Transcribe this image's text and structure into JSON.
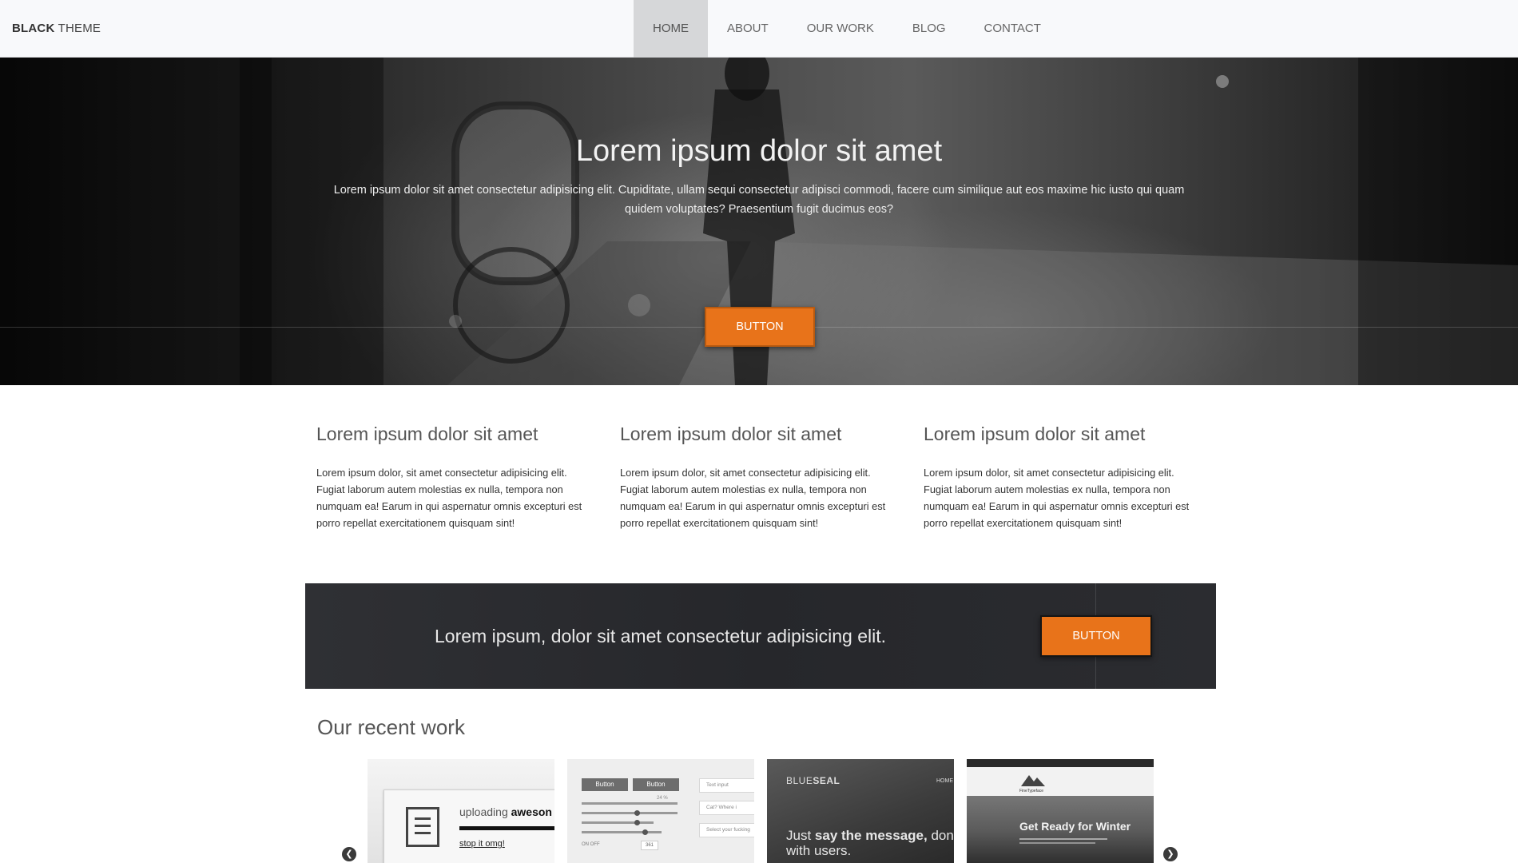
{
  "brand": {
    "bold": "BLACK",
    "light": "THEME"
  },
  "nav": [
    {
      "label": "HOME",
      "active": true
    },
    {
      "label": "ABOUT",
      "active": false
    },
    {
      "label": "OUR WORK",
      "active": false
    },
    {
      "label": "BLOG",
      "active": false
    },
    {
      "label": "CONTACT",
      "active": false
    }
  ],
  "hero": {
    "title": "Lorem ipsum dolor sit amet",
    "text": "Lorem ipsum dolor sit amet consectetur adipisicing elit. Cupiditate, ullam sequi consectetur adipisci commodi, facere cum similique aut eos maxime hic iusto qui quam quidem voluptates? Praesentium fugit ducimus eos?",
    "button": "BUTTON"
  },
  "features": [
    {
      "title": "Lorem ipsum dolor sit amet",
      "text": "Lorem ipsum dolor, sit amet consectetur adipisicing elit. Fugiat laborum autem molestias ex nulla, tempora non numquam ea! Earum in qui aspernatur omnis excepturi est porro repellat exercitationem quisquam sint!"
    },
    {
      "title": "Lorem ipsum dolor sit amet",
      "text": "Lorem ipsum dolor, sit amet consectetur adipisicing elit. Fugiat laborum autem molestias ex nulla, tempora non numquam ea! Earum in qui aspernatur omnis excepturi est porro repellat exercitationem quisquam sint!"
    },
    {
      "title": "Lorem ipsum dolor sit amet",
      "text": "Lorem ipsum dolor, sit amet consectetur adipisicing elit. Fugiat laborum autem molestias ex nulla, tempora non numquam ea! Earum in qui aspernatur omnis excepturi est porro repellat exercitationem quisquam sint!"
    }
  ],
  "cta": {
    "text": "Lorem ipsum, dolor sit amet consectetur adipisicing elit.",
    "button": "BUTTON"
  },
  "recent_work": {
    "title": "Our recent work",
    "prev_icon": "chevron-left-icon",
    "next_icon": "chevron-right-icon",
    "thumbs": [
      {
        "text_prefix": "uploading",
        "text_bold": "aweson",
        "link": "stop it omg!"
      },
      {
        "btn1": "Button",
        "btn2": "Button",
        "input1": "Text input",
        "input2": "Cat? Where i",
        "input3": "Select your fucking",
        "slider_value": "24 %",
        "toggle_on": "ON",
        "toggle_off": "OFF",
        "stepper": "361"
      },
      {
        "logo_light": "BLUE",
        "logo_bold": "SEAL",
        "nav": "HOME",
        "msg_prefix": "Just",
        "msg_bold": "say the message,",
        "msg_suffix": "don",
        "msg_line2": "with users."
      },
      {
        "brand_small": "FineTypeface",
        "headline": "Get Ready for Winter"
      }
    ]
  },
  "colors": {
    "accent": "#e8731a",
    "nav_active": "#d6d7d9",
    "cta_bg": "#2a2b2f"
  }
}
